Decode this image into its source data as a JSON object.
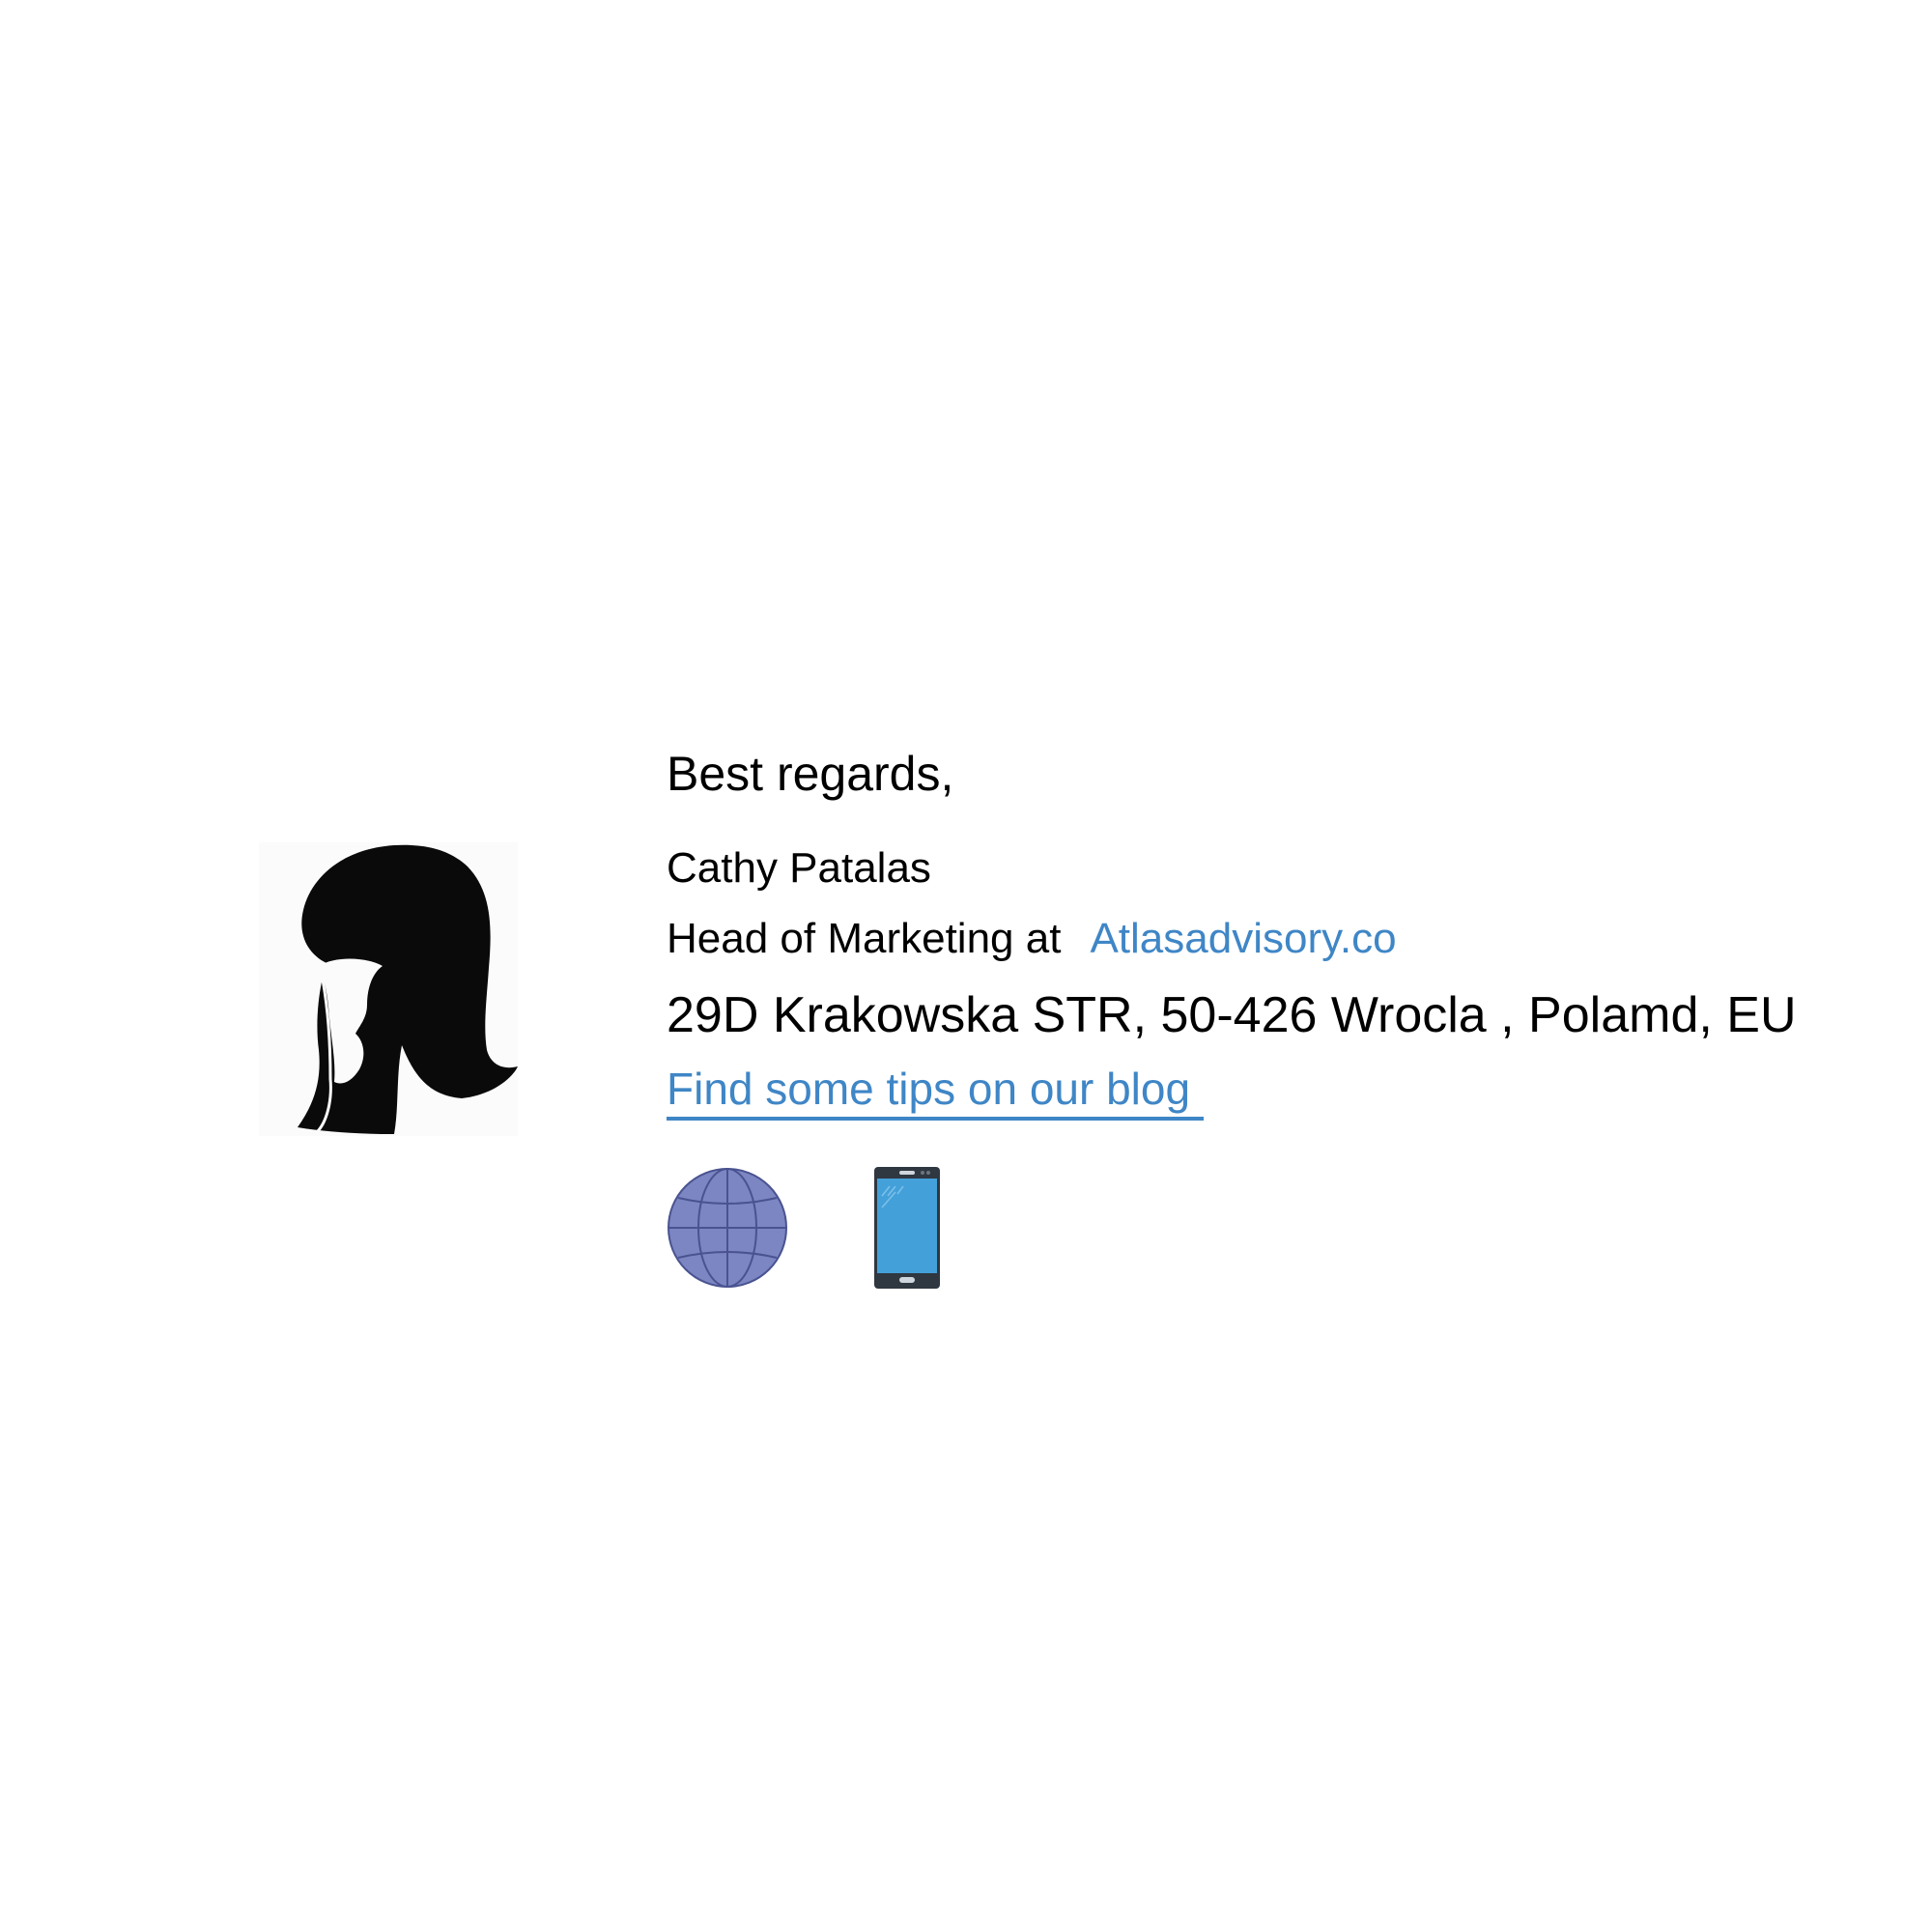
{
  "signature": {
    "greeting": "Best regards,",
    "name": "Cathy Patalas",
    "role_prefix": "Head of Marketing at",
    "company_link": "Atlasadvisory.co",
    "address": "29D Krakowska STR, 50-426 Wrocla , Polamd, EU",
    "blog_link": "Find some tips on our blog"
  },
  "icons": {
    "avatar": "woman-silhouette-icon",
    "website": "globe-icon",
    "phone": "smartphone-icon"
  },
  "colors": {
    "link": "#3f86c6",
    "globe_fill": "#7b86c2",
    "phone_screen": "#44a0d9",
    "phone_body": "#2f3740"
  }
}
